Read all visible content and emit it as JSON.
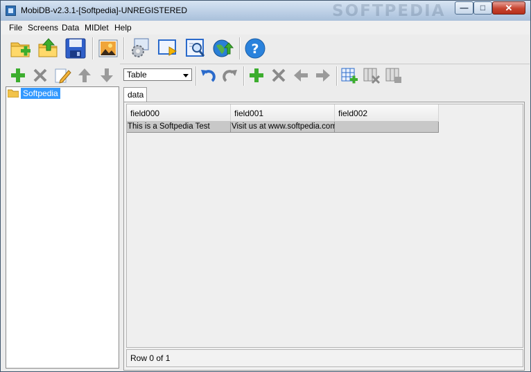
{
  "window": {
    "title": "MobiDB-v2.3.1-[Softpedia]-UNREGISTERED",
    "watermark": "SOFTPEDIA"
  },
  "menu": [
    "File",
    "Screens",
    "Data",
    "MIDlet",
    "Help"
  ],
  "toolbar": {
    "icons": [
      "new-database-icon",
      "upload-icon",
      "save-icon",
      "image-icon",
      "settings-icon",
      "preview-screen-icon",
      "search-screen-icon",
      "globe-upload-icon",
      "help-icon"
    ]
  },
  "left_toolbar": {
    "icons": [
      "add-icon",
      "delete-icon",
      "edit-icon",
      "move-up-icon",
      "move-down-icon"
    ]
  },
  "tree": {
    "items": [
      {
        "label": "Softpedia",
        "icon": "folder-icon"
      }
    ]
  },
  "right_toolbar": {
    "view_select": "Table",
    "icons": [
      "undo-icon",
      "redo-icon",
      "add-record-icon",
      "delete-record-icon",
      "previous-icon",
      "next-icon",
      "add-column-icon",
      "delete-column-icon",
      "column-settings-icon"
    ]
  },
  "tabs": [
    {
      "label": "data"
    }
  ],
  "table": {
    "columns": [
      "field000",
      "field001",
      "field002"
    ],
    "rows": [
      [
        "This is a Softpedia Test",
        "Visit us at www.softpedia.com",
        ""
      ]
    ]
  },
  "status": "Row 0 of 1",
  "colors": {
    "selection": "#3399ff",
    "row_bg": "#c8c8c8"
  }
}
